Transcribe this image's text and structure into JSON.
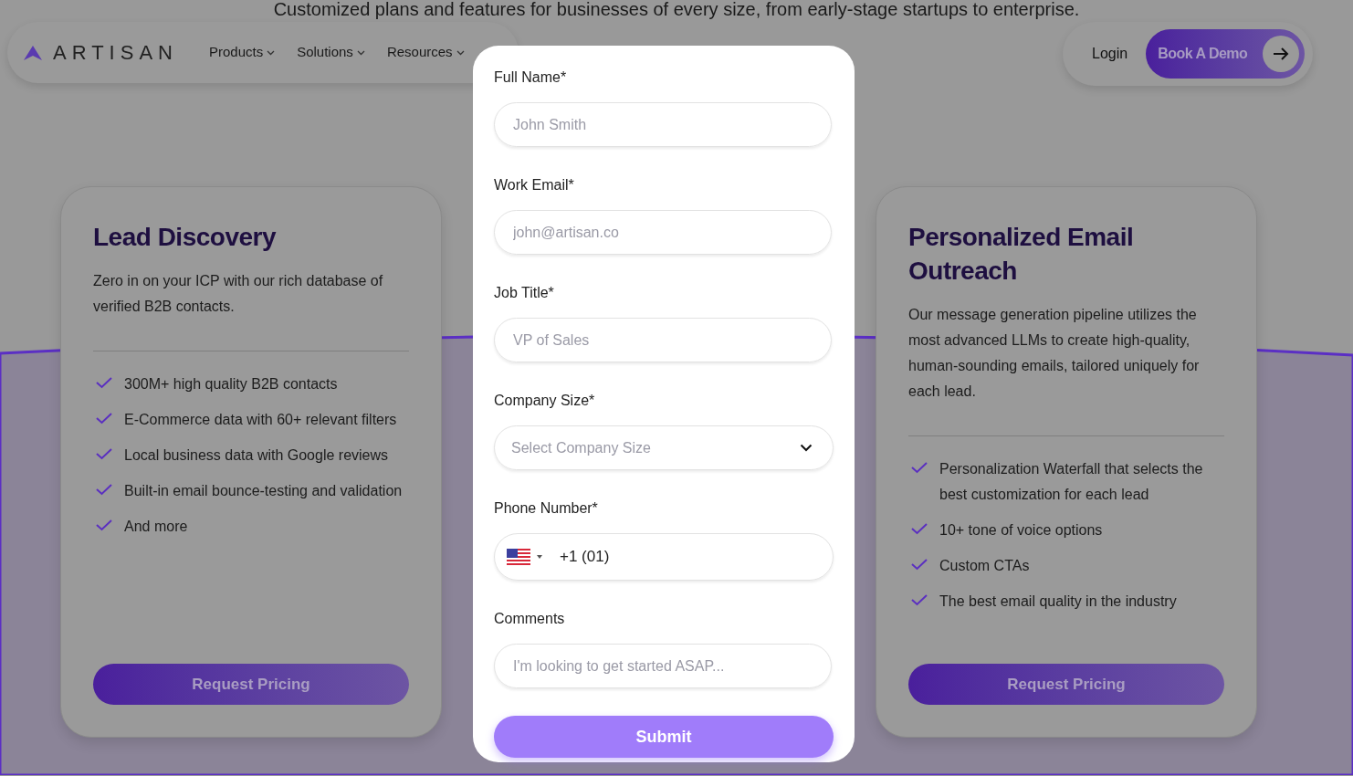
{
  "headline": "Customized plans and features for businesses of every size, from early-stage startups to enterprise.",
  "nav": {
    "logo": "ARTISAN",
    "menu": [
      {
        "label": "Products"
      },
      {
        "label": "Solutions"
      },
      {
        "label": "Resources"
      }
    ],
    "login": "Login",
    "cta": "Book A Demo"
  },
  "cards": [
    {
      "title": "Lead Discovery",
      "description": "Zero in on your ICP with our rich database of verified B2B contacts.",
      "features": [
        "300M+ high quality B2B contacts",
        "E-Commerce data with 60+ relevant filters",
        "Local business data with Google reviews",
        "Built-in email bounce-testing and validation",
        "And more"
      ],
      "button": "Request Pricing"
    },
    {
      "title": "Personalized Email Outreach",
      "description": "Our message generation pipeline utilizes the most advanced LLMs to create high-quality, human-sounding emails, tailored uniquely for each lead.",
      "features": [
        "Personalization Waterfall that selects the best customization for each lead",
        "10+ tone of voice options",
        "Custom CTAs",
        "The best email quality in the industry"
      ],
      "button": "Request Pricing"
    }
  ],
  "form": {
    "fields": [
      {
        "kind": "text",
        "label": "Full Name*",
        "placeholder": "John Smith"
      },
      {
        "kind": "text",
        "label": "Work Email*",
        "placeholder": "john@artisan.co"
      },
      {
        "kind": "text",
        "label": "Job Title*",
        "placeholder": "VP of Sales"
      },
      {
        "kind": "select",
        "label": "Company Size*",
        "placeholder": "Select Company Size"
      },
      {
        "kind": "phone",
        "label": "Phone Number*",
        "value": "+1 (01)"
      },
      {
        "kind": "text",
        "label": "Comments",
        "placeholder": "I'm looking to get started ASAP..."
      }
    ],
    "submit": "Submit"
  }
}
